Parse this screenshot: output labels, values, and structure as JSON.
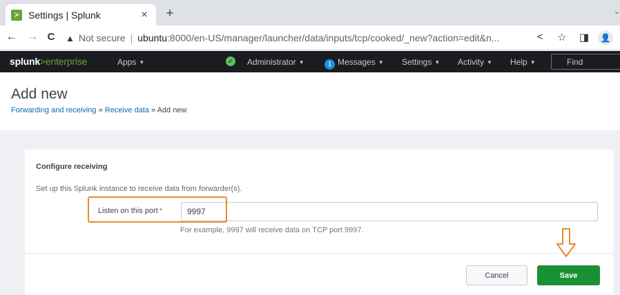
{
  "browser": {
    "tab_title": "Settings | Splunk",
    "tab_close": "×",
    "new_tab": "+",
    "menu_caret": "⌄",
    "not_secure": "Not secure",
    "url_host": "ubuntu",
    "url_rest": ":8000/en-US/manager/launcher/data/inputs/tcp/cooked/_new?action=edit&n...",
    "back": "←",
    "forward": "→",
    "reload": "C",
    "share": "<",
    "star": "☆",
    "sidepanel": "◨",
    "profile": "👤"
  },
  "splunkbar": {
    "logo_main": "splunk",
    "logo_gt": ">",
    "logo_product": "enterprise",
    "apps": "Apps",
    "administrator": "Administrator",
    "messages_count": "1",
    "messages": "Messages",
    "settings": "Settings",
    "activity": "Activity",
    "help": "Help",
    "find": "Find"
  },
  "page": {
    "title": "Add new",
    "breadcrumb": [
      "Forwarding and receiving",
      "Receive data",
      "Add new"
    ],
    "breadcrumb_sep": " » "
  },
  "form": {
    "section_title": "Configure receiving",
    "help_text": "Set up this Splunk instance to receive data from forwarder(s).",
    "port_label": "Listen on this port",
    "required_mark": "*",
    "port_value": "9997",
    "port_help": "For example, 9997 will receive data on TCP port 9997.",
    "cancel": "Cancel",
    "save": "Save"
  },
  "colors": {
    "highlight": "#e88a2a",
    "save_green": "#1a9035",
    "link_blue": "#006eaa",
    "splunk_green": "#65a637"
  }
}
